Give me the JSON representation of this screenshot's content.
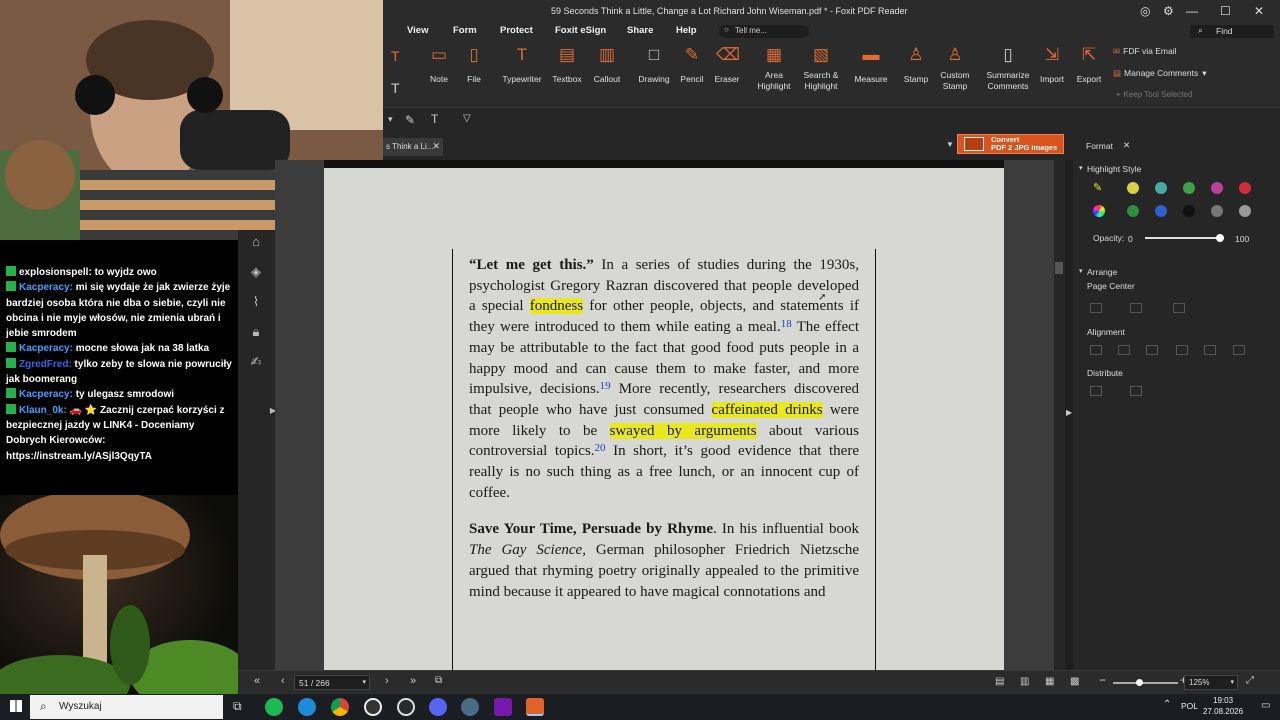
{
  "window": {
    "title": "59 Seconds Think a Little, Change a Lot Richard John Wiseman.pdf * - Foxit PDF Reader"
  },
  "menu": [
    "View",
    "Form",
    "Protect",
    "Foxit eSign",
    "Share",
    "Help"
  ],
  "tell_me": "Tell me...",
  "find": "Find",
  "ribbon": {
    "note": "Note",
    "file": "File",
    "typewriter": "Typewriter",
    "textbox": "Textbox",
    "callout": "Callout",
    "drawing": "Drawing",
    "pencil": "Pencil",
    "eraser": "Eraser",
    "area_highlight": "Area\nHighlight",
    "search_highlight": "Search &\nHighlight",
    "measure": "Measure",
    "stamp": "Stamp",
    "custom_stamp": "Custom\nStamp",
    "summarize_comments": "Summarize\nComments",
    "import": "Import",
    "export": "Export",
    "fdf_via_email": "FDF via Email",
    "manage_comments": "Manage Comments",
    "keep_tool_selected": "Keep Tool Selected"
  },
  "tab": {
    "label": "s Think a Li..."
  },
  "convert": {
    "line1": "Convert",
    "line2": "PDF 2 JPG Images"
  },
  "document": {
    "p1_bold": "“Let me get this.”",
    "p1_a": " In a series of studies during the 1930s, psychologist Gregory Razran discovered that people developed a special ",
    "hl_fondness": "fondness",
    "p1_b": " for other people, objects, and statements if they were introduced to them while eating a meal.",
    "fn18": "18",
    "p1_c": " The effect may be attributable to the fact that good food puts people in a happy mood and can cause them to make faster, and more impulsive, decisions.",
    "fn19": "19",
    "p1_d": " More recently, researchers discovered that people who have just consumed ",
    "hl_caffeinated": "caffeinated drinks",
    "p1_e": " were more likely to be ",
    "hl_swayed": "swayed by arguments",
    "p1_f": " about various controversial topics.",
    "fn20": "20",
    "p1_g": " In short, it’s good evidence that there really is no such thing as a free lunch, or an innocent cup of coffee.",
    "p2_bold": "Save Your Time, Persuade by Rhyme",
    "p2_a": ". In his influential book ",
    "p2_italic": "The Gay Science",
    "p2_b": ", German philosopher Friedrich Nietzsche argued that rhyming poetry originally appealed to the primitive mind because it appeared to have magical connotations and"
  },
  "format_panel": {
    "tab": "Format",
    "highlight_style": "Highlight Style",
    "opacity_label": "Opacity:",
    "opacity_min": "0",
    "opacity_max": "100",
    "opacity_value": 1.0,
    "arrange": "Arrange",
    "page_center": "Page Center",
    "alignment": "Alignment",
    "distribute": "Distribute",
    "swatches_row1": [
      "#d7cf4a",
      "#4aa7a2",
      "#3e9f4b",
      "#b8429b",
      "#cc2e3a"
    ],
    "swatches_row2": [
      "#2f8e3a",
      "#2f5fc8",
      "#111111",
      "#777777",
      "#9a9a9a"
    ]
  },
  "status": {
    "page": "51 / 266",
    "zoom": "125%"
  },
  "chat": [
    {
      "user": "",
      "msg": "explosionspell:  to wyjdz owo",
      "color": "#ffffff"
    },
    {
      "user": "Kacperacy:",
      "msg": " mi się wydaje że jak zwierze żyje bardziej osoba która nie dba o siebie, czyli nie obcina i nie myje włosów, nie zmienia ubrań i jebie smrodem",
      "color": "#3aa3ff"
    },
    {
      "user": "Kacperacy:",
      "msg": " mocne słowa jak na 38 latka",
      "color": "#3aa3ff"
    },
    {
      "user": "ZgredFred:",
      "msg": " tylko zeby te slowa nie powruciły jak boomerang",
      "color": "#3a62e8"
    },
    {
      "user": "Kacperacy:",
      "msg": " ty ulegasz smrodowi",
      "color": "#3aa3ff"
    },
    {
      "user": "Klaun_0k:",
      "msg": " 🚗 ⭐ Zacznij czerpać korzyści z bezpiecznej jazdy w LINK4 - Doceniamy Dobrych Kierowców: https://instream.ly/ASjl3QqyTA",
      "color": "#3aa3ff"
    }
  ],
  "taskbar": {
    "search": "Wyszukaj",
    "lang": "POL",
    "time": "19:03",
    "date": "27.08.2026"
  }
}
